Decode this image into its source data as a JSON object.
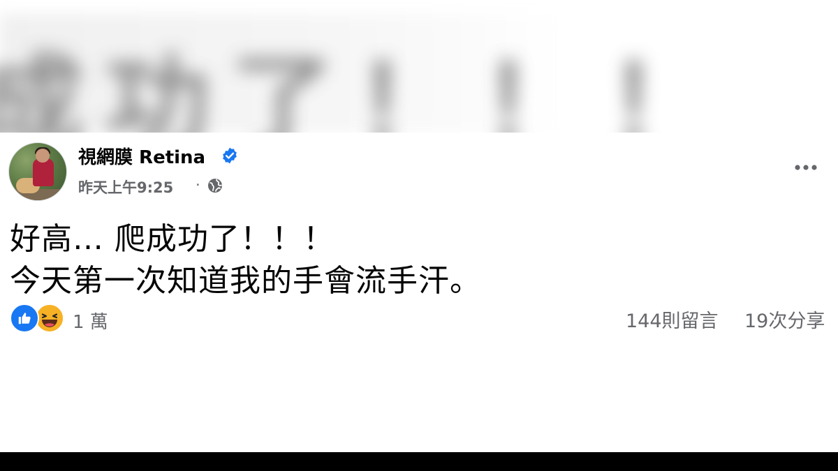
{
  "blurred_header": {
    "text": "成功了！！！"
  },
  "post": {
    "author": {
      "name": "視網膜 Retina",
      "verified": true,
      "avatar_icon": "profile-photo"
    },
    "timestamp": "昨天上午9:25",
    "separator": "·",
    "privacy_icon": "globe-icon",
    "menu_icon": "more-options-icon",
    "text_lines": [
      "好高… 爬成功了！！！",
      "今天第一次知道我的手會流手汗。"
    ],
    "reactions": {
      "icons": [
        "like-icon",
        "haha-icon"
      ],
      "count": "1 萬"
    },
    "comments": "144則留言",
    "shares": "19次分享"
  },
  "colors": {
    "text_primary": "#050505",
    "text_secondary": "#65676b",
    "verified_blue": "#1877f2",
    "like_blue": "#1877f2",
    "haha_yellow": "#f7b125"
  }
}
